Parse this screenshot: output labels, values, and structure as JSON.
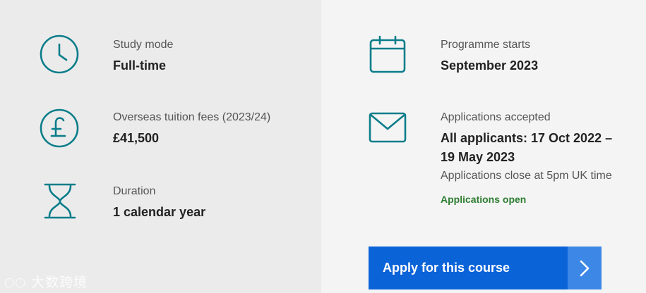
{
  "study_mode": {
    "label": "Study mode",
    "value": "Full-time",
    "icon": "clock-icon"
  },
  "fees": {
    "label": "Overseas tuition fees (2023/24)",
    "value": "£41,500",
    "icon": "pound-icon"
  },
  "duration": {
    "label": "Duration",
    "value": "1 calendar year",
    "icon": "hourglass-icon"
  },
  "programme_starts": {
    "label": "Programme starts",
    "value": "September 2023",
    "icon": "calendar-icon"
  },
  "applications": {
    "label": "Applications accepted",
    "value_line1": "All applicants: 17 Oct 2022 –",
    "value_line2": "19 May 2023",
    "note": "Applications close at 5pm UK time",
    "status": "Applications open",
    "icon": "envelope-icon"
  },
  "apply_button": {
    "label": "Apply for this course"
  },
  "watermark": "大数跨境",
  "colors": {
    "accent": "#0b7d8a",
    "button": "#0b63d8",
    "button_arrow": "#3d87e6",
    "status": "#2e7d32"
  }
}
